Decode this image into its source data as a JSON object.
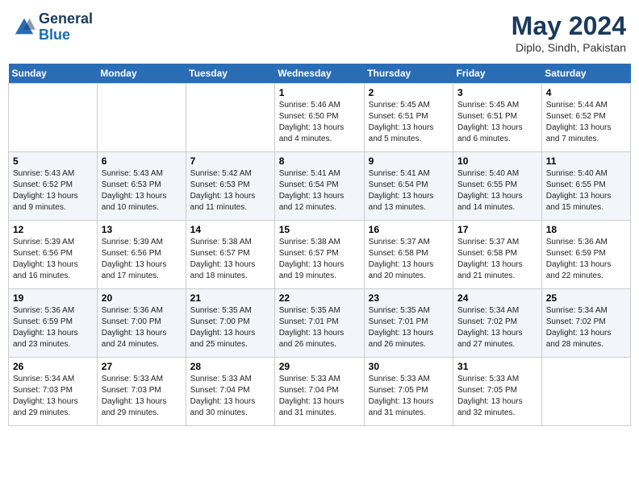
{
  "header": {
    "logo_line1": "General",
    "logo_line2": "Blue",
    "month": "May 2024",
    "location": "Diplo, Sindh, Pakistan"
  },
  "weekdays": [
    "Sunday",
    "Monday",
    "Tuesday",
    "Wednesday",
    "Thursday",
    "Friday",
    "Saturday"
  ],
  "weeks": [
    [
      {
        "day": "",
        "info": ""
      },
      {
        "day": "",
        "info": ""
      },
      {
        "day": "",
        "info": ""
      },
      {
        "day": "1",
        "info": "Sunrise: 5:46 AM\nSunset: 6:50 PM\nDaylight: 13 hours and 4 minutes."
      },
      {
        "day": "2",
        "info": "Sunrise: 5:45 AM\nSunset: 6:51 PM\nDaylight: 13 hours and 5 minutes."
      },
      {
        "day": "3",
        "info": "Sunrise: 5:45 AM\nSunset: 6:51 PM\nDaylight: 13 hours and 6 minutes."
      },
      {
        "day": "4",
        "info": "Sunrise: 5:44 AM\nSunset: 6:52 PM\nDaylight: 13 hours and 7 minutes."
      }
    ],
    [
      {
        "day": "5",
        "info": "Sunrise: 5:43 AM\nSunset: 6:52 PM\nDaylight: 13 hours and 9 minutes."
      },
      {
        "day": "6",
        "info": "Sunrise: 5:43 AM\nSunset: 6:53 PM\nDaylight: 13 hours and 10 minutes."
      },
      {
        "day": "7",
        "info": "Sunrise: 5:42 AM\nSunset: 6:53 PM\nDaylight: 13 hours and 11 minutes."
      },
      {
        "day": "8",
        "info": "Sunrise: 5:41 AM\nSunset: 6:54 PM\nDaylight: 13 hours and 12 minutes."
      },
      {
        "day": "9",
        "info": "Sunrise: 5:41 AM\nSunset: 6:54 PM\nDaylight: 13 hours and 13 minutes."
      },
      {
        "day": "10",
        "info": "Sunrise: 5:40 AM\nSunset: 6:55 PM\nDaylight: 13 hours and 14 minutes."
      },
      {
        "day": "11",
        "info": "Sunrise: 5:40 AM\nSunset: 6:55 PM\nDaylight: 13 hours and 15 minutes."
      }
    ],
    [
      {
        "day": "12",
        "info": "Sunrise: 5:39 AM\nSunset: 6:56 PM\nDaylight: 13 hours and 16 minutes."
      },
      {
        "day": "13",
        "info": "Sunrise: 5:39 AM\nSunset: 6:56 PM\nDaylight: 13 hours and 17 minutes."
      },
      {
        "day": "14",
        "info": "Sunrise: 5:38 AM\nSunset: 6:57 PM\nDaylight: 13 hours and 18 minutes."
      },
      {
        "day": "15",
        "info": "Sunrise: 5:38 AM\nSunset: 6:57 PM\nDaylight: 13 hours and 19 minutes."
      },
      {
        "day": "16",
        "info": "Sunrise: 5:37 AM\nSunset: 6:58 PM\nDaylight: 13 hours and 20 minutes."
      },
      {
        "day": "17",
        "info": "Sunrise: 5:37 AM\nSunset: 6:58 PM\nDaylight: 13 hours and 21 minutes."
      },
      {
        "day": "18",
        "info": "Sunrise: 5:36 AM\nSunset: 6:59 PM\nDaylight: 13 hours and 22 minutes."
      }
    ],
    [
      {
        "day": "19",
        "info": "Sunrise: 5:36 AM\nSunset: 6:59 PM\nDaylight: 13 hours and 23 minutes."
      },
      {
        "day": "20",
        "info": "Sunrise: 5:36 AM\nSunset: 7:00 PM\nDaylight: 13 hours and 24 minutes."
      },
      {
        "day": "21",
        "info": "Sunrise: 5:35 AM\nSunset: 7:00 PM\nDaylight: 13 hours and 25 minutes."
      },
      {
        "day": "22",
        "info": "Sunrise: 5:35 AM\nSunset: 7:01 PM\nDaylight: 13 hours and 26 minutes."
      },
      {
        "day": "23",
        "info": "Sunrise: 5:35 AM\nSunset: 7:01 PM\nDaylight: 13 hours and 26 minutes."
      },
      {
        "day": "24",
        "info": "Sunrise: 5:34 AM\nSunset: 7:02 PM\nDaylight: 13 hours and 27 minutes."
      },
      {
        "day": "25",
        "info": "Sunrise: 5:34 AM\nSunset: 7:02 PM\nDaylight: 13 hours and 28 minutes."
      }
    ],
    [
      {
        "day": "26",
        "info": "Sunrise: 5:34 AM\nSunset: 7:03 PM\nDaylight: 13 hours and 29 minutes."
      },
      {
        "day": "27",
        "info": "Sunrise: 5:33 AM\nSunset: 7:03 PM\nDaylight: 13 hours and 29 minutes."
      },
      {
        "day": "28",
        "info": "Sunrise: 5:33 AM\nSunset: 7:04 PM\nDaylight: 13 hours and 30 minutes."
      },
      {
        "day": "29",
        "info": "Sunrise: 5:33 AM\nSunset: 7:04 PM\nDaylight: 13 hours and 31 minutes."
      },
      {
        "day": "30",
        "info": "Sunrise: 5:33 AM\nSunset: 7:05 PM\nDaylight: 13 hours and 31 minutes."
      },
      {
        "day": "31",
        "info": "Sunrise: 5:33 AM\nSunset: 7:05 PM\nDaylight: 13 hours and 32 minutes."
      },
      {
        "day": "",
        "info": ""
      }
    ]
  ]
}
